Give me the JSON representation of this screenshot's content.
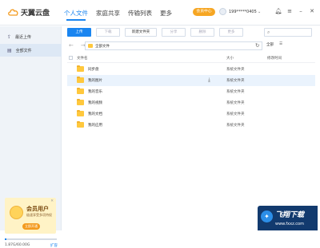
{
  "app": {
    "name": "天翼云盘"
  },
  "nav": {
    "tabs": [
      {
        "label": "个人文件"
      },
      {
        "label": "家庭共享"
      },
      {
        "label": "传输列表"
      },
      {
        "label": "更多"
      }
    ]
  },
  "header": {
    "vip_label": "会员中心",
    "account": "199*****0405"
  },
  "sidebar": {
    "items": [
      {
        "label": "最近上传"
      },
      {
        "label": "全部文件"
      }
    ]
  },
  "promo": {
    "title": "会员用户",
    "subtitle": "极速享受多项特权",
    "button": "立即开通"
  },
  "storage": {
    "text": "1.87G/60.00G",
    "expand": "扩容",
    "used_fraction": 0.031
  },
  "toolbar": {
    "upload": "上传",
    "download": "下载",
    "new_folder": "新建文件夹",
    "share": "分享",
    "delete": "删除",
    "more": "更多"
  },
  "address": {
    "path": "全部文件",
    "view_all": "全部",
    "view_mode": "☰"
  },
  "table": {
    "headers": {
      "name": "文件名",
      "size": "大小",
      "modified": "修改时间"
    },
    "rows": [
      {
        "name": "同步盘",
        "type": "系统文件夹"
      },
      {
        "name": "我的图片",
        "type": "系统文件夹"
      },
      {
        "name": "我的音乐",
        "type": "系统文件夹"
      },
      {
        "name": "我的视频",
        "type": "系统文件夹"
      },
      {
        "name": "我的文档",
        "type": "系统文件夹"
      },
      {
        "name": "我的应用",
        "type": "系统文件夹"
      }
    ]
  },
  "watermark": {
    "title": "飞翔下载",
    "url": "www.fxxz.com"
  }
}
